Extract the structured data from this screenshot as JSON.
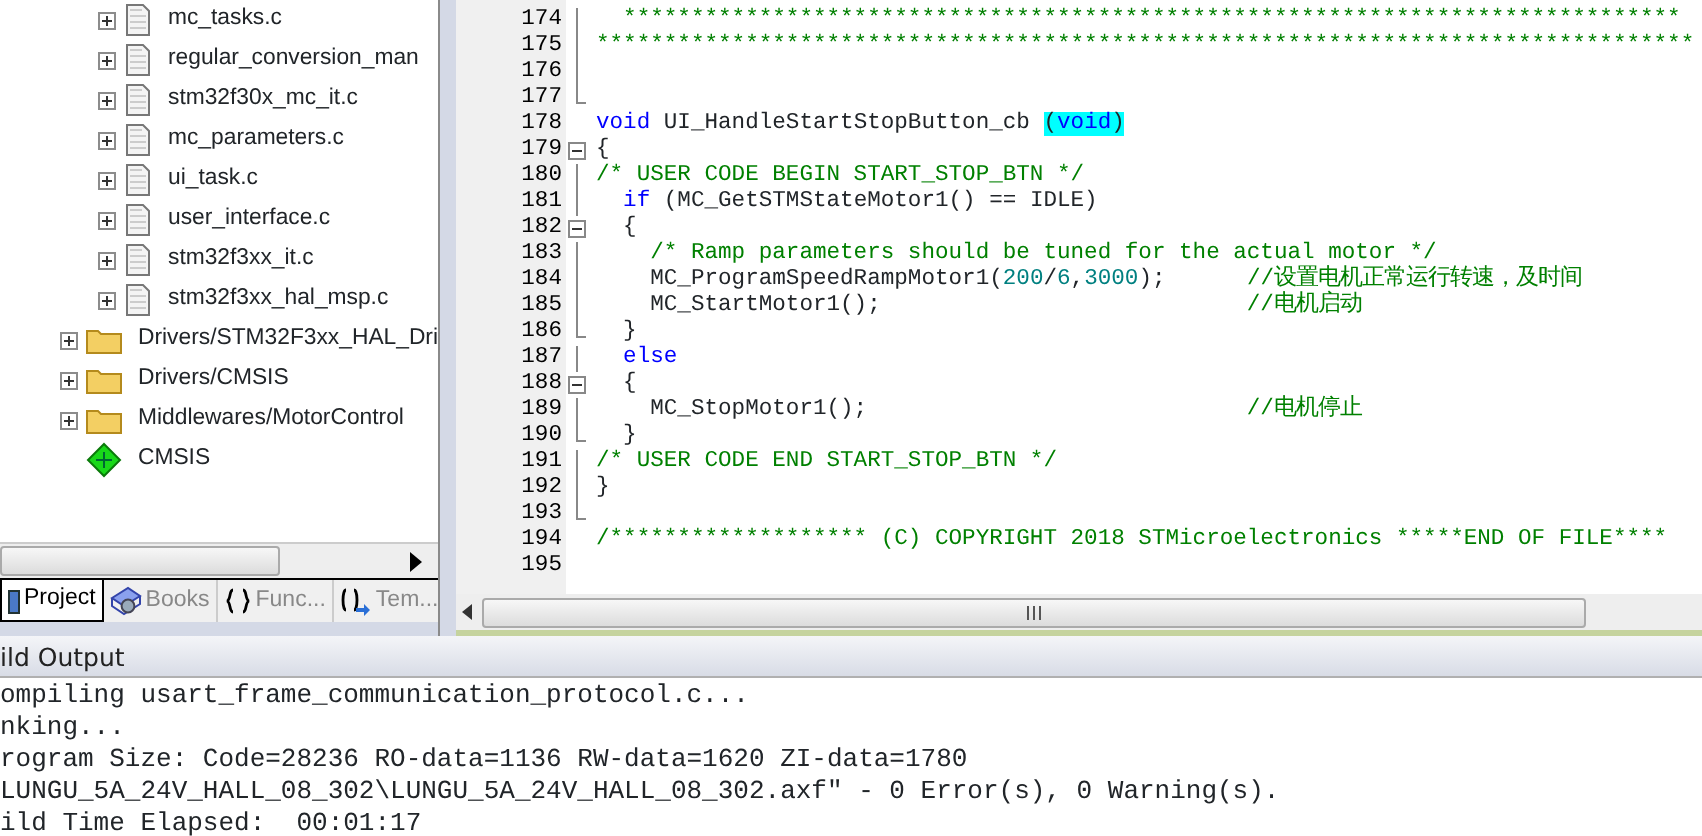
{
  "project_tree": [
    {
      "children": [
        {
          "kind": "file",
          "label": "mc_tasks.c",
          "expanded": false
        },
        {
          "kind": "file",
          "label": "regular_conversion_man",
          "expanded": false
        },
        {
          "kind": "file",
          "label": "stm32f30x_mc_it.c",
          "expanded": false
        },
        {
          "kind": "file",
          "label": "mc_parameters.c",
          "expanded": false
        },
        {
          "kind": "file",
          "label": "ui_task.c",
          "expanded": false
        },
        {
          "kind": "file",
          "label": "user_interface.c",
          "expanded": false
        },
        {
          "kind": "file",
          "label": "stm32f3xx_it.c",
          "expanded": false
        },
        {
          "kind": "file",
          "label": "stm32f3xx_hal_msp.c",
          "expanded": false
        }
      ]
    },
    {
      "kind": "folder",
      "label": "Drivers/STM32F3xx_HAL_Dri",
      "expanded": false
    },
    {
      "kind": "folder",
      "label": "Drivers/CMSIS",
      "expanded": false
    },
    {
      "kind": "folder",
      "label": "Middlewares/MotorControl",
      "expanded": false
    },
    {
      "kind": "component",
      "label": "CMSIS"
    }
  ],
  "panel_tabs": [
    {
      "kind": "project",
      "label": "Project",
      "selected": true
    },
    {
      "kind": "books",
      "label": "Books",
      "selected": false
    },
    {
      "kind": "functions",
      "label": "Func...",
      "selected": false
    },
    {
      "kind": "templates",
      "label": "Tem...",
      "selected": false
    }
  ],
  "code_lines": [
    {
      "number": "174",
      "kind": "fold-line",
      "segments": [
        {
          "kind": "comment",
          "text": "  ******************************************************************************"
        }
      ]
    },
    {
      "number": "175",
      "kind": "fold-line",
      "segments": [
        {
          "kind": "comment",
          "text": "*********************************************************************************"
        }
      ]
    },
    {
      "number": "176",
      "kind": "fold-line"
    },
    {
      "number": "177",
      "kind": "fold-end"
    },
    {
      "number": "178",
      "kind": "plain",
      "segments": [
        {
          "kind": "keyword",
          "text": "void"
        },
        {
          "kind": "plain",
          "text": " UI_HandleStartStopButton_cb "
        },
        {
          "kind": "match",
          "text": "("
        },
        {
          "kind": "keyword-match",
          "text": "void"
        },
        {
          "kind": "match",
          "text": ")"
        }
      ]
    },
    {
      "number": "179",
      "kind": "fold-start",
      "segments": [
        {
          "kind": "plain",
          "text": "{"
        }
      ]
    },
    {
      "number": "180",
      "kind": "fold-line",
      "segments": [
        {
          "kind": "comment",
          "text": "/* USER CODE BEGIN START_STOP_BTN */"
        }
      ]
    },
    {
      "number": "181",
      "kind": "fold-line",
      "segments": [
        {
          "kind": "keyword",
          "text": "  if"
        },
        {
          "kind": "plain",
          "text": " (MC_GetSTMStateMotor1() == IDLE)"
        }
      ]
    },
    {
      "number": "182",
      "kind": "fold-start",
      "segments": [
        {
          "kind": "plain",
          "text": "  {"
        }
      ]
    },
    {
      "number": "183",
      "kind": "fold-line",
      "segments": [
        {
          "kind": "comment",
          "text": "    /* Ramp parameters should be tuned for the actual motor */"
        }
      ]
    },
    {
      "number": "184",
      "kind": "fold-line",
      "segments": [
        {
          "kind": "plain",
          "text": "    MC_ProgramSpeedRampMotor1("
        },
        {
          "kind": "number",
          "text": "200"
        },
        {
          "kind": "plain",
          "text": "/"
        },
        {
          "kind": "number",
          "text": "6"
        },
        {
          "kind": "plain",
          "text": ","
        },
        {
          "kind": "number",
          "text": "3000"
        },
        {
          "kind": "plain",
          "text": ");      "
        },
        {
          "kind": "comment",
          "text": "//设置电机正常运行转速，及时间"
        }
      ]
    },
    {
      "number": "185",
      "kind": "fold-line",
      "segments": [
        {
          "kind": "plain",
          "text": "    MC_StartMotor1();                           "
        },
        {
          "kind": "comment",
          "text": "//电机启动"
        }
      ]
    },
    {
      "number": "186",
      "kind": "fold-end",
      "segments": [
        {
          "kind": "plain",
          "text": "  }"
        }
      ]
    },
    {
      "number": "187",
      "kind": "fold-line",
      "segments": [
        {
          "kind": "keyword",
          "text": "  else"
        }
      ]
    },
    {
      "number": "188",
      "kind": "fold-start",
      "segments": [
        {
          "kind": "plain",
          "text": "  {"
        }
      ]
    },
    {
      "number": "189",
      "kind": "fold-line",
      "segments": [
        {
          "kind": "plain",
          "text": "    MC_StopMotor1();                            "
        },
        {
          "kind": "comment",
          "text": "//电机停止"
        }
      ]
    },
    {
      "number": "190",
      "kind": "fold-end",
      "segments": [
        {
          "kind": "plain",
          "text": "  }"
        }
      ]
    },
    {
      "number": "191",
      "kind": "fold-line",
      "segments": [
        {
          "kind": "comment",
          "text": "/* USER CODE END START_STOP_BTN */"
        }
      ]
    },
    {
      "number": "192",
      "kind": "fold-line",
      "segments": [
        {
          "kind": "plain",
          "text": "}"
        }
      ]
    },
    {
      "number": "193",
      "kind": "fold-end"
    },
    {
      "number": "194",
      "kind": "plain",
      "segments": [
        {
          "kind": "comment",
          "text": "/******************* (C) COPYRIGHT 2018 STMicroelectronics *****END OF FILE****"
        }
      ]
    },
    {
      "number": "195",
      "kind": "plain"
    }
  ],
  "build_output": {
    "title": "ild Output",
    "lines": [
      "ompiling usart_frame_communication_protocol.c...",
      "nking...",
      "rogram Size: Code=28236 RO-data=1136 RW-data=1620 ZI-data=1780",
      "LUNGU_5A_24V_HALL_08_302\\LUNGU_5A_24V_HALL_08_302.axf\" - 0 Error(s), 0 Warning(s).",
      "ild Time Elapsed:  00:01:17"
    ]
  }
}
